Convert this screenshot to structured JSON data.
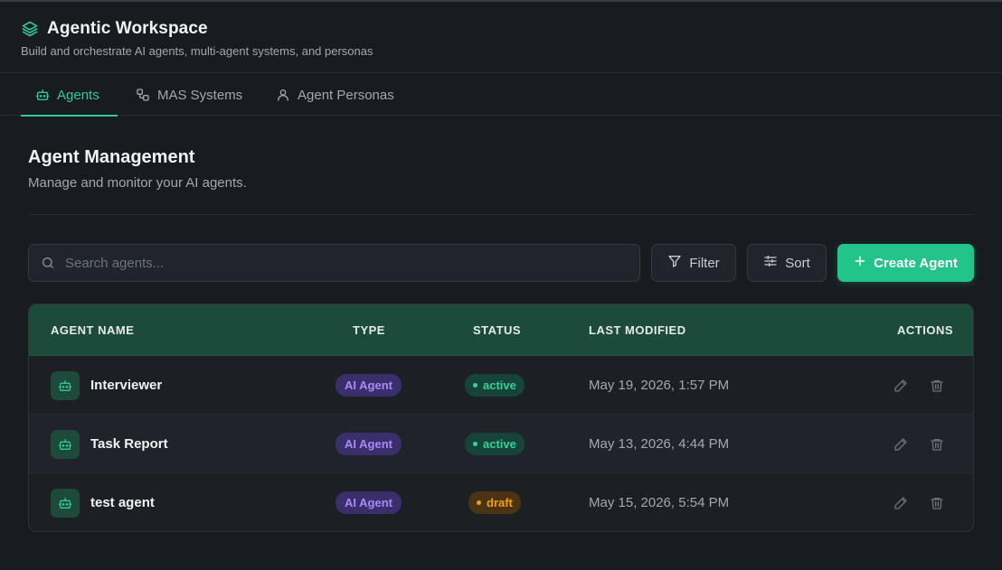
{
  "app": {
    "title": "Agentic Workspace",
    "subtitle": "Build and orchestrate AI agents, multi-agent systems, and personas"
  },
  "tabs": [
    {
      "label": "Agents",
      "icon": "robot-icon",
      "active": true
    },
    {
      "label": "MAS Systems",
      "icon": "workflow-icon",
      "active": false
    },
    {
      "label": "Agent Personas",
      "icon": "user-icon",
      "active": false
    }
  ],
  "page": {
    "title": "Agent Management",
    "subtitle": "Manage and monitor your AI agents."
  },
  "toolbar": {
    "search_placeholder": "Search agents...",
    "filter_label": "Filter",
    "sort_label": "Sort",
    "create_label": "Create Agent"
  },
  "table": {
    "columns": {
      "name": "AGENT NAME",
      "type": "TYPE",
      "status": "STATUS",
      "modified": "LAST MODIFIED",
      "actions": "ACTIONS"
    },
    "rows": [
      {
        "name": "Interviewer",
        "type": "AI Agent",
        "status": "active",
        "modified": "May 19, 2026, 1:57 PM"
      },
      {
        "name": "Task Report",
        "type": "AI Agent",
        "status": "active",
        "modified": "May 13, 2026, 4:44 PM"
      },
      {
        "name": "test agent",
        "type": "AI Agent",
        "status": "draft",
        "modified": "May 15, 2026, 5:54 PM"
      }
    ]
  },
  "colors": {
    "accent": "#23c48b",
    "background": "#181b20",
    "table_header": "#1c4a3b",
    "status_active": "#34d399",
    "status_draft": "#f59e0b",
    "type_badge": "#a78bfa"
  }
}
